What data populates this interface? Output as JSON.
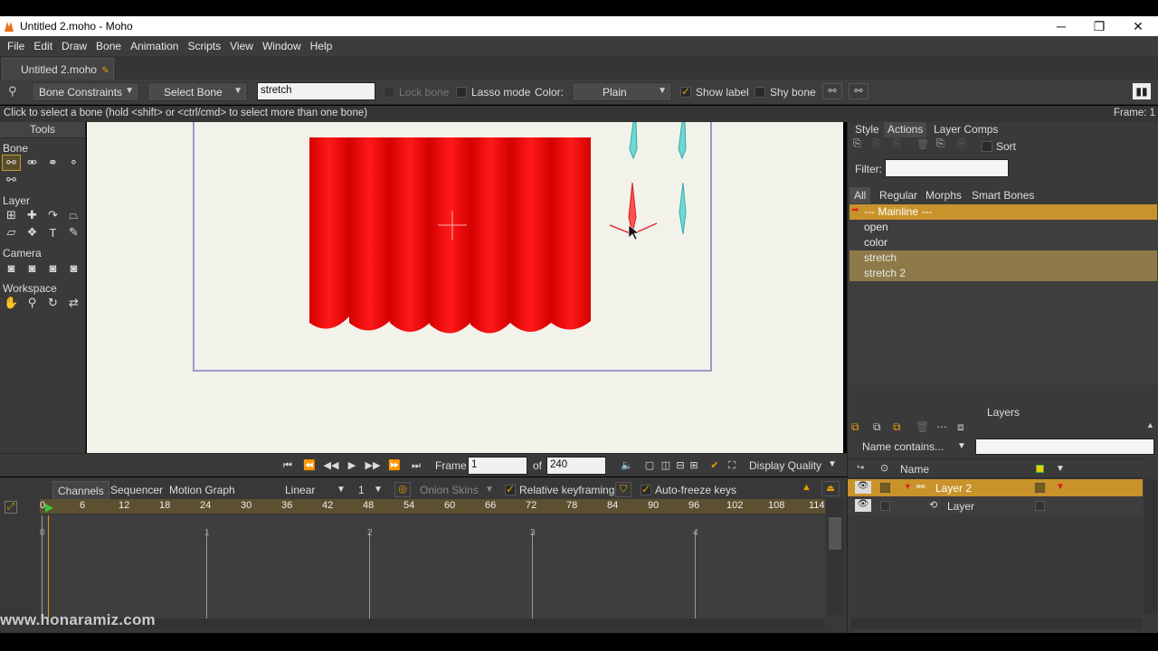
{
  "window": {
    "title": "Untitled 2.moho - Moho",
    "minimize": "─",
    "maximize": "❐",
    "close": "✕"
  },
  "menu": [
    "File",
    "Edit",
    "Draw",
    "Bone",
    "Animation",
    "Scripts",
    "View",
    "Window",
    "Help"
  ],
  "doc_tab": "Untitled 2.moho",
  "options": {
    "bone_constraints": "Bone Constraints",
    "select_bone": "Select Bone",
    "bone_name": "stretch",
    "lock_bone": "Lock bone",
    "lasso_mode": "Lasso mode",
    "color_label": "Color:",
    "color_value": "Plain",
    "show_label": "Show label",
    "show_label_checked": true,
    "shy_bone": "Shy bone"
  },
  "status": {
    "hint": "Click to select a bone (hold <shift> or <ctrl/cmd> to select more than one bone)",
    "frame": "Frame: 1"
  },
  "tools": {
    "header": "Tools",
    "sections": {
      "bone": "Bone",
      "layer": "Layer",
      "camera": "Camera",
      "workspace": "Workspace"
    }
  },
  "playback": {
    "frame_label": "Frame",
    "frame_value": "1",
    "of_label": "of",
    "total": "240",
    "display_quality": "Display Quality"
  },
  "timeline": {
    "tabs": [
      "Channels",
      "Sequencer",
      "Motion Graph"
    ],
    "interp": "Linear",
    "interp_num": "1",
    "onion_skins": "Onion Skins",
    "relative_keyframing": "Relative keyframing",
    "auto_freeze": "Auto-freeze keys",
    "ruler": [
      "0",
      "6",
      "12",
      "18",
      "24",
      "30",
      "36",
      "42",
      "48",
      "54",
      "60",
      "66",
      "72",
      "78",
      "84",
      "90",
      "96",
      "102",
      "108",
      "114"
    ],
    "seconds": [
      "0",
      "1",
      "2",
      "3",
      "4"
    ]
  },
  "right_panel": {
    "tabs": [
      "Style",
      "Actions",
      "Layer Comps"
    ],
    "sort": "Sort",
    "filter_label": "Filter:",
    "subtabs": [
      "All",
      "Regular",
      "Morphs",
      "Smart Bones"
    ],
    "actions": [
      {
        "label": "--- Mainline ---",
        "highlight": true
      },
      {
        "label": "open",
        "highlight": false
      },
      {
        "label": "color",
        "highlight": false
      },
      {
        "label": "stretch",
        "highlight": "soft"
      },
      {
        "label": "stretch 2",
        "highlight": "soft"
      }
    ]
  },
  "layers": {
    "header": "Layers",
    "name_filter": "Name contains...",
    "name_col": "Name",
    "items": [
      {
        "name": "Layer 2",
        "selected": true
      },
      {
        "name": "Layer",
        "selected": false
      }
    ]
  },
  "watermark": "www.honaramiz.com",
  "colors": {
    "accent": "#c8932a",
    "curtain": "#ff0000",
    "bone_cyan": "#5fd0c8",
    "bone_red": "#e03030"
  }
}
